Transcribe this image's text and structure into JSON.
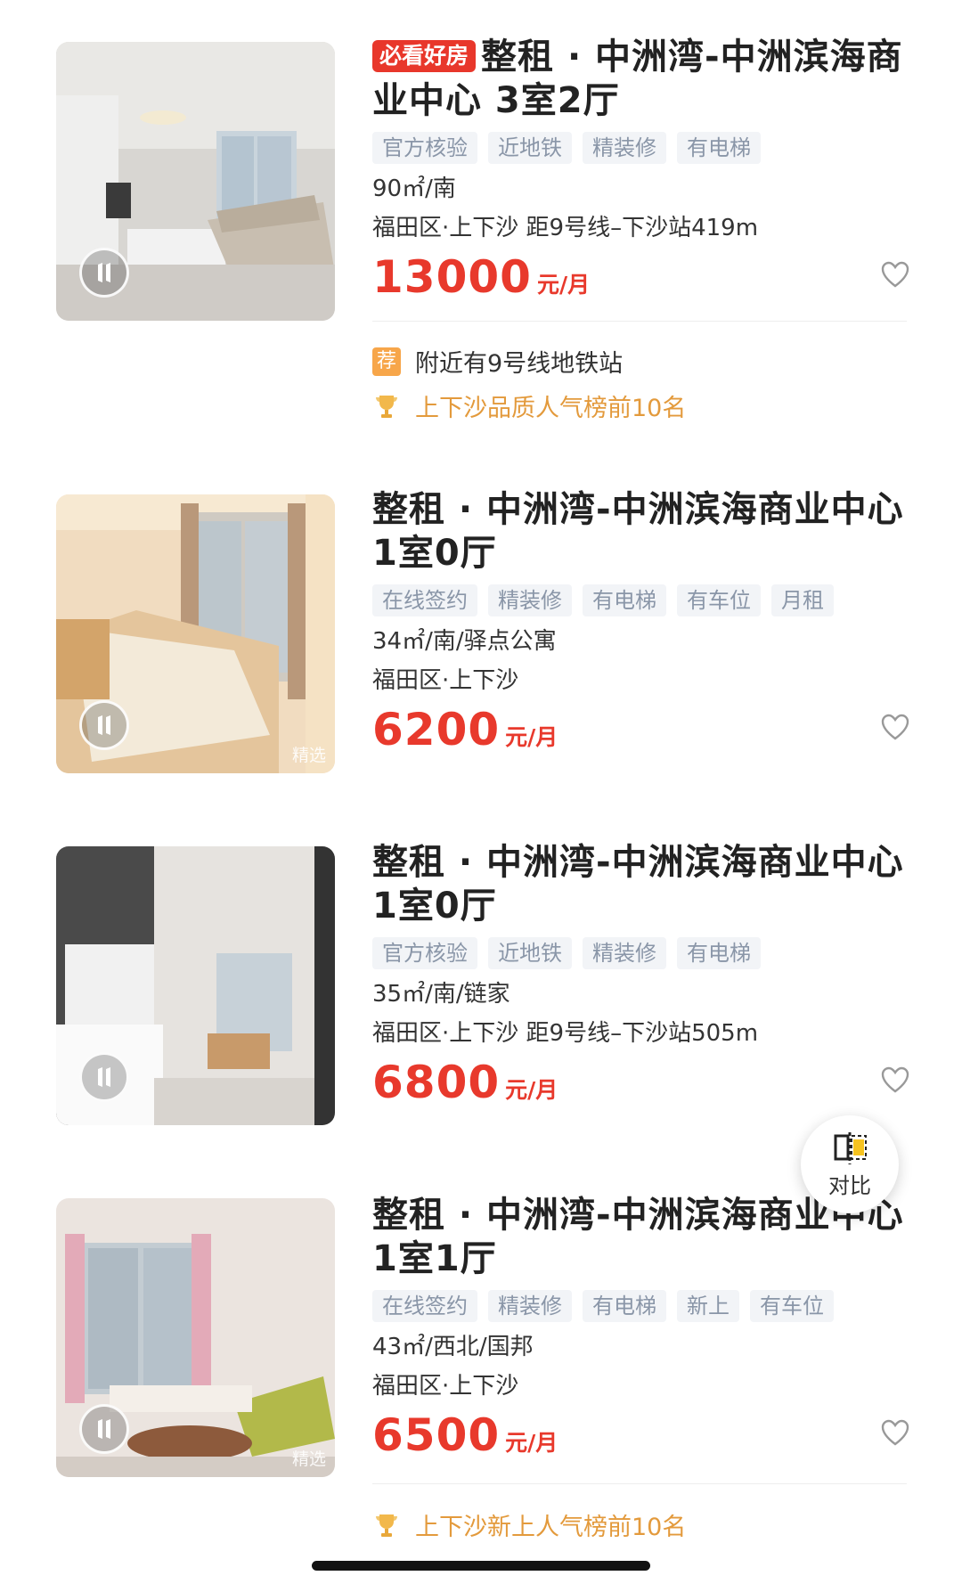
{
  "listings": [
    {
      "badge": "必看好房",
      "title": "整租 · 中洲湾-中洲滨海商业中心 3室2厅",
      "tags": [
        "官方核验",
        "近地铁",
        "精装修",
        "有电梯"
      ],
      "meta1": "90㎡/南",
      "meta2": "福田区·上下沙 距9号线–下沙站419m",
      "price": "13000",
      "unit": "元/月",
      "recommend_badge": "荐",
      "recommend_text": "附近有9号线地铁站",
      "rank_text": "上下沙品质人气榜前10名"
    },
    {
      "title": "整租 · 中洲湾-中洲滨海商业中心 1室0厅",
      "tags": [
        "在线签约",
        "精装修",
        "有电梯",
        "有车位",
        "月租"
      ],
      "meta1": "34㎡/南/驿点公寓",
      "meta2": "福田区·上下沙",
      "price": "6200",
      "unit": "元/月",
      "select_tag": "精选"
    },
    {
      "title": "整租 · 中洲湾-中洲滨海商业中心 1室0厅",
      "tags": [
        "官方核验",
        "近地铁",
        "精装修",
        "有电梯"
      ],
      "meta1": "35㎡/南/链家",
      "meta2": "福田区·上下沙 距9号线–下沙站505m",
      "price": "6800",
      "unit": "元/月"
    },
    {
      "title": "整租 · 中洲湾-中洲滨海商业中心 1室1厅",
      "tags": [
        "在线签约",
        "精装修",
        "有电梯",
        "新上",
        "有车位"
      ],
      "meta1": "43㎡/西北/国邦",
      "meta2": "福田区·上下沙",
      "price": "6500",
      "unit": "元/月",
      "select_tag": "精选",
      "rank_text": "上下沙新上人气榜前10名"
    }
  ],
  "compare": {
    "label": "对比"
  },
  "colors": {
    "price": "#e8392c",
    "badge": "#e8372b",
    "rank": "#e39a3c",
    "tag_text": "#8a96a8",
    "tag_bg": "#f2f4f7"
  },
  "icons": [
    "vr-tour-icon",
    "heart-icon",
    "trophy-icon",
    "compare-icon"
  ]
}
